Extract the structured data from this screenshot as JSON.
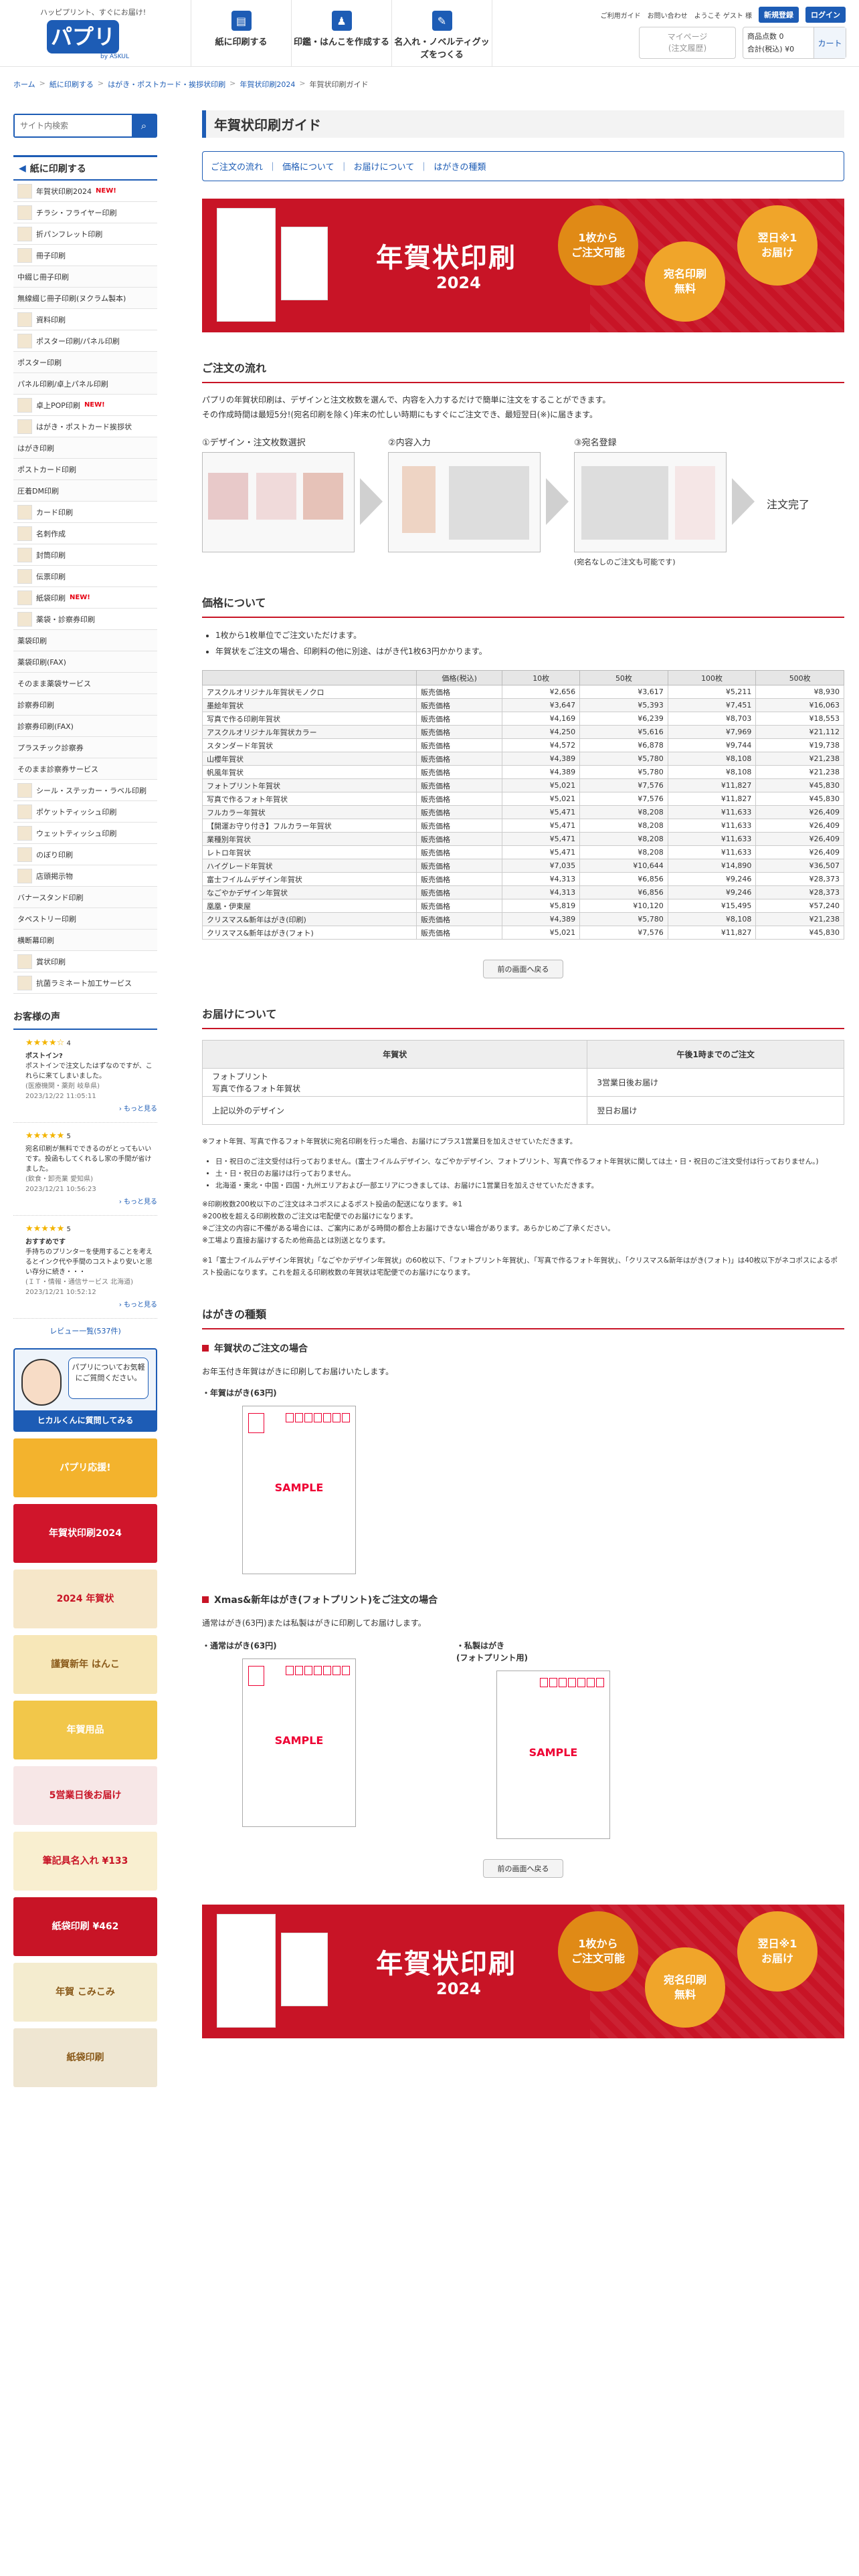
{
  "header": {
    "tagline": "ハッピプリント、すぐにお届け!",
    "logo": "パプリ",
    "logo_sub": "by ASKUL",
    "nav": [
      "紙に印刷する",
      "印鑑・はんこを作成する",
      "名入れ・ノベルティグッズをつくる"
    ],
    "util": [
      "ご利用ガイド",
      "お問い合わせ",
      "ようこそ ゲスト 様"
    ],
    "register": "新規登録",
    "login": "ログイン",
    "mypage": "マイページ\n(注文履歴)",
    "cart_items_label": "商品点数",
    "cart_items": "0",
    "cart_total_label": "合計(税込)",
    "cart_total": "¥0",
    "cart_label": "カート"
  },
  "breadcrumb": [
    "ホーム",
    "紙に印刷する",
    "はがき・ポストカード・挨拶状印刷",
    "年賀状印刷2024",
    "年賀状印刷ガイド"
  ],
  "sidebar": {
    "search_placeholder": "サイト内検索",
    "heading": "紙に印刷する",
    "items": [
      {
        "label": "年賀状印刷2024",
        "new": "NEW!",
        "sub": false
      },
      {
        "label": "チラシ・フライヤー印刷",
        "sub": false
      },
      {
        "label": "折パンフレット印刷",
        "sub": false
      },
      {
        "label": "冊子印刷",
        "sub": false
      },
      {
        "label": "中綴じ冊子印刷",
        "sub": true
      },
      {
        "label": "無線綴じ冊子印刷(ヌクラム製本)",
        "sub": true
      },
      {
        "label": "資料印刷",
        "sub": false
      },
      {
        "label": "ポスター印刷/パネル印刷",
        "sub": false
      },
      {
        "label": "ポスター印刷",
        "sub": true
      },
      {
        "label": "パネル印刷/卓上パネル印刷",
        "sub": true
      },
      {
        "label": "卓上POP印刷",
        "new": "NEW!",
        "sub": false
      },
      {
        "label": "はがき・ポストカード挨拶状",
        "sub": false
      },
      {
        "label": "はがき印刷",
        "sub": true
      },
      {
        "label": "ポストカード印刷",
        "sub": true
      },
      {
        "label": "圧着DM印刷",
        "sub": true
      },
      {
        "label": "カード印刷",
        "sub": false
      },
      {
        "label": "名刺作成",
        "sub": false
      },
      {
        "label": "封筒印刷",
        "sub": false
      },
      {
        "label": "伝票印刷",
        "sub": false
      },
      {
        "label": "紙袋印刷",
        "new": "NEW!",
        "sub": false
      },
      {
        "label": "薬袋・診察券印刷",
        "sub": false
      },
      {
        "label": "薬袋印刷",
        "sub": true
      },
      {
        "label": "薬袋印刷(FAX)",
        "sub": true
      },
      {
        "label": "そのまま薬袋サービス",
        "sub": true
      },
      {
        "label": "診察券印刷",
        "sub": true
      },
      {
        "label": "診察券印刷(FAX)",
        "sub": true
      },
      {
        "label": "プラスチック診察券",
        "sub": true
      },
      {
        "label": "そのまま診察券サービス",
        "sub": true
      },
      {
        "label": "シール・ステッカー・ラベル印刷",
        "sub": false
      },
      {
        "label": "ポケットティッシュ印刷",
        "sub": false
      },
      {
        "label": "ウェットティッシュ印刷",
        "sub": false
      },
      {
        "label": "のぼり印刷",
        "sub": false
      },
      {
        "label": "店頭掲示物",
        "sub": false
      },
      {
        "label": "バナースタンド印刷",
        "sub": true
      },
      {
        "label": "タペストリー印刷",
        "sub": true
      },
      {
        "label": "横断幕印刷",
        "sub": true
      },
      {
        "label": "賞状印刷",
        "sub": false
      },
      {
        "label": "抗菌ラミネート加工サービス",
        "sub": false
      }
    ],
    "review_heading": "お客様の声",
    "reviews": [
      {
        "stars": "★★★★☆",
        "score": "4",
        "title": "ポストイン?",
        "text": "ポストインで注文したはずなのですが、これらに来てしまいました。",
        "who": "(医療機関・薬剤 岐阜県)",
        "date": "2023/12/22 11:05:11",
        "more": "もっと見る"
      },
      {
        "stars": "★★★★★",
        "score": "5",
        "title": "",
        "text": "宛名印刷が無料でできるのがとってもいいです。投函もしてくれるし家の手間が省けました。",
        "who": "(飲食・卸売業 愛知県)",
        "date": "2023/12/21 10:56:23",
        "more": "もっと見る"
      },
      {
        "stars": "★★★★★",
        "score": "5",
        "title": "おすすめです",
        "text": "手持ちのプリンターを使用することを考えるとインク代や手間のコストより安いと思い存分に続き・・・",
        "who": "(ＩＴ・情報・通信サービス 北海道)",
        "date": "2023/12/21 10:52:12",
        "more": "もっと見る"
      }
    ],
    "review_all": "レビュー一覧(537件)",
    "mascot_text": "パプリについてお気軽にご質問ください。",
    "mascot_bar": "ヒカルくんに質問してみる",
    "banners": [
      "パプリ応援!",
      "年賀状印刷2024",
      "2024 年賀状",
      "謹賀新年 はんこ",
      "年賀用品",
      "5営業日後お届け",
      "筆記具名入れ ¥133",
      "紙袋印刷 ¥462",
      "年賀 こみこみ",
      "紙袋印刷"
    ]
  },
  "main": {
    "title": "年賀状印刷ガイド",
    "anchors": [
      "ご注文の流れ",
      "価格について",
      "お届けについて",
      "はがきの種類"
    ],
    "hero": {
      "title": "年賀状印刷",
      "year": "2024",
      "badge1": "1枚から\nご注文可能",
      "badge2": "宛名印刷\n無料",
      "badge3": "翌日※1\nお届け"
    },
    "flow_heading": "ご注文の流れ",
    "flow_text1": "パプリの年賀状印刷は、デザインと注文枚数を選んで、内容を入力するだけで簡単に注文をすることができます。",
    "flow_text2": "その作成時間は最短5分!(宛名印刷を除く)年末の忙しい時期にもすぐにご注文でき、最短翌日(※)に届きます。",
    "steps": [
      "①デザイン・注文枚数選択",
      "②内容入力",
      "③宛名登録"
    ],
    "flow_done": "注文完了",
    "flow_note": "(宛名なしのご注文も可能です)",
    "price_heading": "価格について",
    "price_bullets": [
      "1枚から1枚単位でご注文いただけます。",
      "年賀状をご注文の場合、印刷料の他に別途、はがき代1枚63円かかります。"
    ],
    "price_cols": [
      "",
      "価格(税込)",
      "10枚",
      "50枚",
      "100枚",
      "500枚"
    ],
    "price_rows": [
      [
        "アスクルオリジナル年賀状モノクロ",
        "販売価格",
        "¥2,656",
        "¥3,617",
        "¥5,211",
        "¥8,930"
      ],
      [
        "墨絵年賀状",
        "販売価格",
        "¥3,647",
        "¥5,393",
        "¥7,451",
        "¥16,063"
      ],
      [
        "写真で作る印刷年賀状",
        "販売価格",
        "¥4,169",
        "¥6,239",
        "¥8,703",
        "¥18,553"
      ],
      [
        "アスクルオリジナル年賀状カラー",
        "販売価格",
        "¥4,250",
        "¥5,616",
        "¥7,969",
        "¥21,112"
      ],
      [
        "スタンダード年賀状",
        "販売価格",
        "¥4,572",
        "¥6,878",
        "¥9,744",
        "¥19,738"
      ],
      [
        "山櫻年賀状",
        "販売価格",
        "¥4,389",
        "¥5,780",
        "¥8,108",
        "¥21,238"
      ],
      [
        "帆風年賀状",
        "販売価格",
        "¥4,389",
        "¥5,780",
        "¥8,108",
        "¥21,238"
      ],
      [
        "フォトプリント年賀状",
        "販売価格",
        "¥5,021",
        "¥7,576",
        "¥11,827",
        "¥45,830"
      ],
      [
        "写真で作るフォト年賀状",
        "販売価格",
        "¥5,021",
        "¥7,576",
        "¥11,827",
        "¥45,830"
      ],
      [
        "フルカラー年賀状",
        "販売価格",
        "¥5,471",
        "¥8,208",
        "¥11,633",
        "¥26,409"
      ],
      [
        "【開運お守り付き】フルカラー年賀状",
        "販売価格",
        "¥5,471",
        "¥8,208",
        "¥11,633",
        "¥26,409"
      ],
      [
        "業種別年賀状",
        "販売価格",
        "¥5,471",
        "¥8,208",
        "¥11,633",
        "¥26,409"
      ],
      [
        "レトロ年賀状",
        "販売価格",
        "¥5,471",
        "¥8,208",
        "¥11,633",
        "¥26,409"
      ],
      [
        "ハイグレード年賀状",
        "販売価格",
        "¥7,035",
        "¥10,644",
        "¥14,890",
        "¥36,507"
      ],
      [
        "富士フイルムデザイン年賀状",
        "販売価格",
        "¥4,313",
        "¥6,856",
        "¥9,246",
        "¥28,373"
      ],
      [
        "なごやかデザイン年賀状",
        "販売価格",
        "¥4,313",
        "¥6,856",
        "¥9,246",
        "¥28,373"
      ],
      [
        "凰凰・伊東屋",
        "販売価格",
        "¥5,819",
        "¥10,120",
        "¥15,495",
        "¥57,240"
      ],
      [
        "クリスマス&新年はがき(印刷)",
        "販売価格",
        "¥4,389",
        "¥5,780",
        "¥8,108",
        "¥21,238"
      ],
      [
        "クリスマス&新年はがき(フォト)",
        "販売価格",
        "¥5,021",
        "¥7,576",
        "¥11,827",
        "¥45,830"
      ]
    ],
    "back": "前の画面へ戻る",
    "delivery_heading": "お届けについて",
    "delivery_cols": [
      "年賀状",
      "午後1時までのご注文"
    ],
    "delivery_rows": [
      [
        "フォトプリント\n写真で作るフォト年賀状",
        "3営業日後お届け"
      ],
      [
        "上記以外のデザイン",
        "翌日お届け"
      ]
    ],
    "delivery_notes": [
      "※フォト年賀、写真で作るフォト年賀状に宛名印刷を行った場合、お届けにプラス1営業日を加えさせていただきます。",
      "日・祝日のご注文受付は行っておりません。(富士フイルムデザイン、なごやかデザイン、フォトプリント、写真で作るフォト年賀状に関しては土・日・祝日のご注文受付は行っておりません。)",
      "土・日・祝日のお届けは行っておりません。",
      "北海道・東北・中国・四国・九州エリアおよび一部エリアにつきましては、お届けに1営業日を加えさせていただきます。",
      "※印刷枚数200枚以下のご注文はネコポスによるポスト投函の配送になります。※1",
      "※200枚を超える印刷枚数のご注文は宅配便でのお届けになります。",
      "※ご注文の内容に不備がある場合には、ご案内にあがる時間の都合上お届けできない場合があります。あらかじめご了承ください。",
      "※工場より直接お届けするため他商品とは別送となります。",
      "※1「富士フイルムデザイン年賀状」「なごやかデザイン年賀状」の60枚以下、「フォトプリント年賀状」、「写真で作るフォト年賀状」、「クリスマス&新年はがき(フォト)」は40枚以下がネコポスによるポスト投函になります。これを超える印刷枚数の年賀状は宅配便でのお届けになります。"
    ],
    "kinds_heading": "はがきの種類",
    "kind1": "年賀状のご注文の場合",
    "kind1_text": "お年玉付き年賀はがきに印刷してお届けいたします。",
    "kind1_card": "・年賀はがき(63円)",
    "kind2": "Xmas&新年はがき(フォトプリント)をご注文の場合",
    "kind2_text": "通常はがき(63円)または私製はがきに印刷してお届けします。",
    "kind2_card1": "・通常はがき(63円)",
    "kind2_card2": "・私製はがき\n(フォトプリント用)",
    "sample": "SAMPLE"
  }
}
